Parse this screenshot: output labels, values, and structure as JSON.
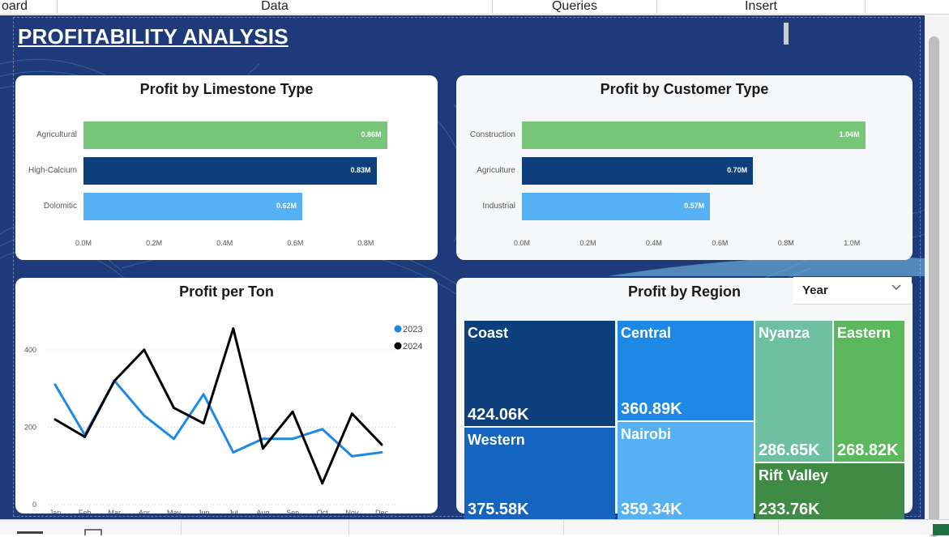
{
  "tabs": [
    "oard",
    "Data",
    "Queries",
    "Insert"
  ],
  "page_title": "PROFITABILITY ANALYSIS",
  "colors": {
    "canvas": "#1f3a7a",
    "green": "#77c67a",
    "navy": "#0d3f7c",
    "lightblue": "#55b1f3",
    "series_2023": "#1e88e5",
    "series_2024": "#000000"
  },
  "slicer": {
    "label": "Year"
  },
  "charts": {
    "limestone": {
      "title": "Profit by Limestone Type"
    },
    "customer": {
      "title": "Profit by Customer Type"
    },
    "ton": {
      "title": "Profit per Ton"
    },
    "region": {
      "title": "Profit by Region"
    }
  },
  "chart_data": [
    {
      "type": "bar",
      "orientation": "horizontal",
      "title": "Profit by Limestone Type",
      "categories": [
        "Agricultural",
        "High-Calcium",
        "Dolomitic"
      ],
      "values": [
        0.86,
        0.83,
        0.62
      ],
      "value_labels": [
        "0.86M",
        "0.83M",
        "0.62M"
      ],
      "bar_colors": [
        "#77c67a",
        "#0d3f7c",
        "#55b1f3"
      ],
      "xlim": [
        0,
        0.9
      ],
      "x_ticks": [
        "0.0M",
        "0.2M",
        "0.4M",
        "0.6M",
        "0.8M"
      ],
      "x_tick_values": [
        0,
        0.2,
        0.4,
        0.6,
        0.8
      ]
    },
    {
      "type": "bar",
      "orientation": "horizontal",
      "title": "Profit by Customer Type",
      "categories": [
        "Construction",
        "Agriculture",
        "Industrial"
      ],
      "values": [
        1.04,
        0.7,
        0.57
      ],
      "value_labels": [
        "1.04M",
        "0.70M",
        "0.57M"
      ],
      "bar_colors": [
        "#77c67a",
        "#0d3f7c",
        "#55b1f3"
      ],
      "xlim": [
        0,
        1.1
      ],
      "x_ticks": [
        "0.0M",
        "0.2M",
        "0.4M",
        "0.6M",
        "0.8M",
        "1.0M"
      ],
      "x_tick_values": [
        0,
        0.2,
        0.4,
        0.6,
        0.8,
        1.0
      ]
    },
    {
      "type": "line",
      "title": "Profit per Ton",
      "categories": [
        "Jan",
        "Feb",
        "Mar",
        "Apr",
        "May",
        "Jun",
        "Jul",
        "Aug",
        "Sep",
        "Oct",
        "Nov",
        "Dec"
      ],
      "ylim": [
        0,
        450
      ],
      "y_ticks": [
        0,
        200,
        400
      ],
      "grid": true,
      "legend_position": "top-right",
      "series": [
        {
          "name": "2023",
          "color": "#1e88e5",
          "values": [
            310,
            180,
            320,
            230,
            170,
            285,
            135,
            170,
            170,
            195,
            125,
            135
          ]
        },
        {
          "name": "2024",
          "color": "#000000",
          "values": [
            220,
            175,
            320,
            400,
            250,
            210,
            455,
            145,
            240,
            55,
            235,
            155
          ]
        }
      ]
    },
    {
      "type": "treemap",
      "title": "Profit by Region",
      "items": [
        {
          "name": "Coast",
          "label": "424.06K",
          "value": 424.06,
          "color": "#0d3f7c"
        },
        {
          "name": "Western",
          "label": "375.58K",
          "value": 375.58,
          "color": "#1565c0"
        },
        {
          "name": "Central",
          "label": "360.89K",
          "value": 360.89,
          "color": "#1e88e5"
        },
        {
          "name": "Nairobi",
          "label": "359.34K",
          "value": 359.34,
          "color": "#55b1f3"
        },
        {
          "name": "Nyanza",
          "label": "286.65K",
          "value": 286.65,
          "color": "#6fbfa3"
        },
        {
          "name": "Eastern",
          "label": "268.82K",
          "value": 268.82,
          "color": "#5cb85c"
        },
        {
          "name": "Rift Valley",
          "label": "233.76K",
          "value": 233.76,
          "color": "#3f8a45"
        }
      ]
    }
  ]
}
